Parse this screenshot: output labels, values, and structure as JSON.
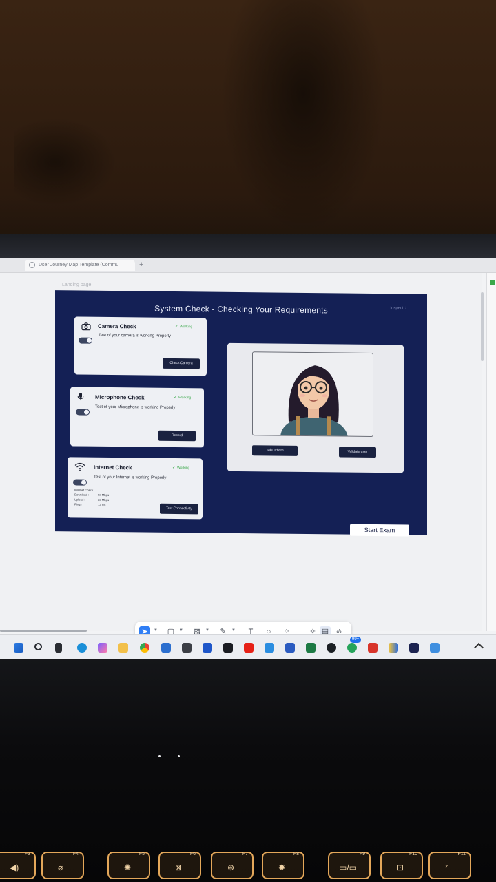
{
  "browser": {
    "tab_title": "User Journey Map Template (Commu",
    "new_tab": "+"
  },
  "canvas": {
    "frame_label": "Landing page"
  },
  "app": {
    "title": "System Check - Checking Your Requirements",
    "brand": "InspectU"
  },
  "camera": {
    "title": "Camera Check",
    "status": "Working",
    "description": "Test of your camera is working Properly",
    "button": "Check Camera",
    "toggle_on": true
  },
  "microphone": {
    "title": "Microphone Check",
    "status": "Working",
    "description": "Test of your Microphone is working Properly",
    "button": "Record",
    "toggle_on": true
  },
  "internet": {
    "title": "Internet  Check",
    "status": "Working",
    "description": "Test of your Internet is working Properly",
    "button": "Test Connectivity",
    "toggle_on": true,
    "stats_heading": "Internet Check",
    "stats": [
      {
        "label": "Download :",
        "value": "50 Mbps"
      },
      {
        "label": "Upload :",
        "value": "22 Mbps"
      },
      {
        "label": "Pings",
        "value": "12 ms"
      }
    ]
  },
  "photo": {
    "take_photo": "Take Photo",
    "validate": "Validate user"
  },
  "start_exam": "Start Exam",
  "toolbar": {
    "icons": [
      "cursor-icon",
      "frame-icon",
      "image-icon",
      "pen-icon",
      "text-icon",
      "comment-icon",
      "shapes-icon",
      "ai-icon",
      "dev-mode-icon",
      "code-icon"
    ],
    "text_tool": "T"
  },
  "taskbar": {
    "badge": "99+"
  },
  "function_keys": [
    "F3",
    "F4",
    "F5",
    "F6",
    "F7",
    "F8",
    "F9",
    "F10",
    "F11"
  ]
}
